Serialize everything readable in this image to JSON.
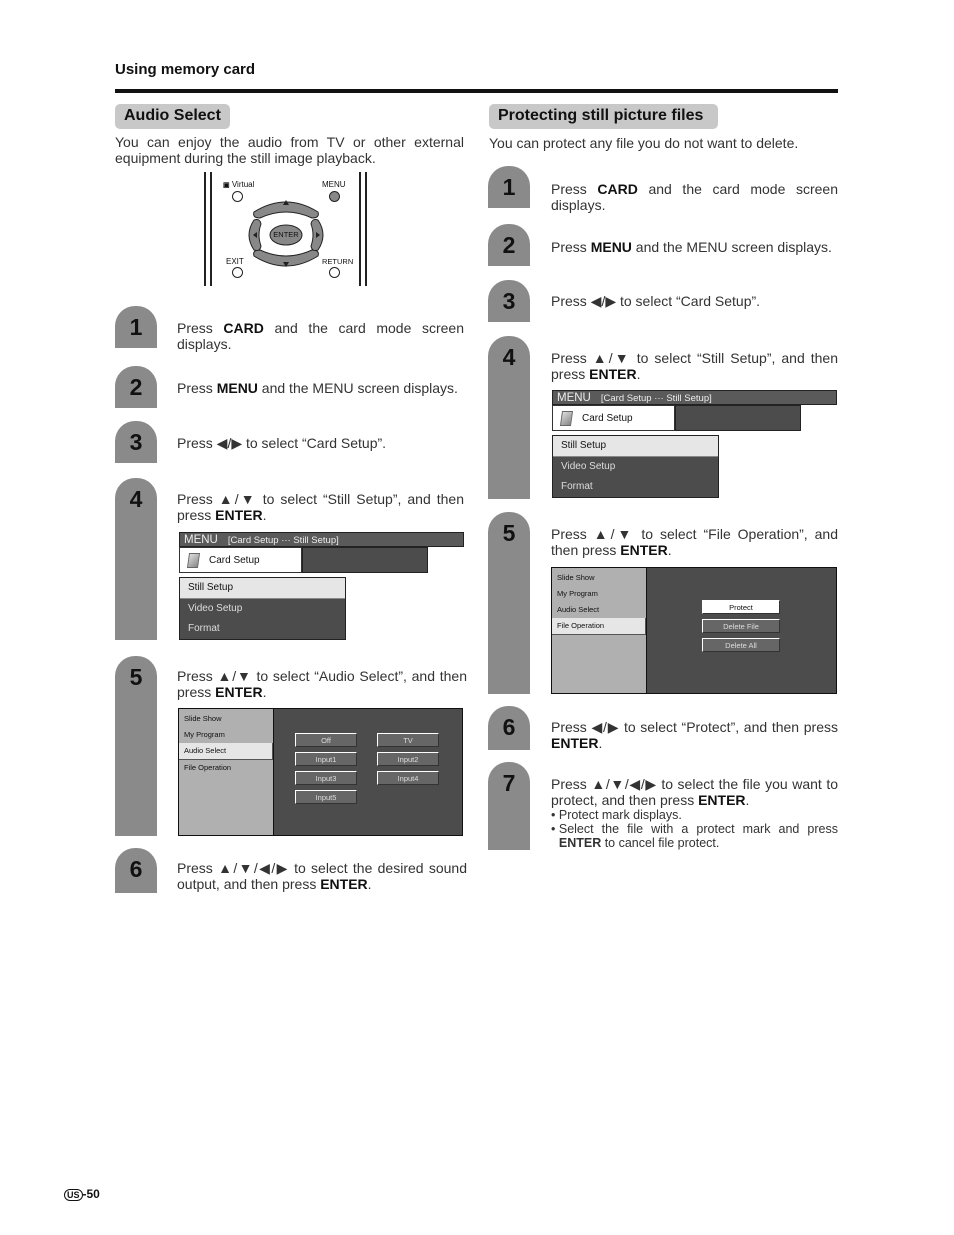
{
  "page": {
    "section_title": "Using memory card",
    "page_number_prefix": "US",
    "page_number": "-50"
  },
  "audio_select": {
    "title": "Audio Select",
    "intro": "You can enjoy the audio from TV or other external equipment during the still image playback.",
    "remote": {
      "virtual_label": "Virtual",
      "menu_label": "MENU",
      "enter_label": "ENTER",
      "exit_label": "EXIT",
      "return_label": "RETURN"
    },
    "steps": [
      {
        "num": "1",
        "pre": "Press ",
        "bold": "CARD",
        "post": " and the card mode screen displays."
      },
      {
        "num": "2",
        "pre": "Press ",
        "bold": "MENU",
        "post": " and the MENU screen displays."
      },
      {
        "num": "3",
        "text": "Press ◀/▶ to select “Card Setup”."
      },
      {
        "num": "4",
        "pre": "Press ▲/▼ to select “Still Setup”, and then press ",
        "bold": "ENTER",
        "post": "."
      },
      {
        "num": "5",
        "pre": "Press ▲/▼ to select “Audio Select”, and then press ",
        "bold": "ENTER",
        "post": "."
      },
      {
        "num": "6",
        "pre": "Press ▲/▼/◀/▶ to select the desired sound output, and then press ",
        "bold": "ENTER",
        "post": "."
      }
    ],
    "menu_screen": {
      "menu": "MENU",
      "path": "[Card Setup ··· Still Setup]",
      "card_setup": "Card Setup",
      "items": [
        "Still Setup",
        "Video Setup",
        "Format"
      ],
      "selected": "Still Setup"
    },
    "option_screen": {
      "left_items": [
        "Slide Show",
        "My Program",
        "Audio Select",
        "File Operation"
      ],
      "selected_left": "Audio Select",
      "options": [
        "Off",
        "TV",
        "Input1",
        "Input2",
        "Input3",
        "Input4",
        "Input5"
      ]
    }
  },
  "protecting": {
    "title": "Protecting still picture files",
    "intro": "You can protect any file you do not want to delete.",
    "steps": [
      {
        "num": "1",
        "pre": "Press ",
        "bold": "CARD",
        "post": " and the card mode screen displays."
      },
      {
        "num": "2",
        "pre": "Press ",
        "bold": "MENU",
        "post": " and the MENU screen displays."
      },
      {
        "num": "3",
        "text": "Press ◀/▶ to select “Card Setup”."
      },
      {
        "num": "4",
        "pre": "Press ▲/▼ to select “Still Setup”, and then press ",
        "bold": "ENTER",
        "post": "."
      },
      {
        "num": "5",
        "pre": "Press ▲/▼ to select “File Operation”, and then press ",
        "bold": "ENTER",
        "post": "."
      },
      {
        "num": "6",
        "pre": "Press ◀/▶ to select “Protect”, and then press ",
        "bold": "ENTER",
        "post": "."
      },
      {
        "num": "7",
        "pre": "Press ▲/▼/◀/▶ to select the file you want to protect, and then press ",
        "bold": "ENTER",
        "post": ".",
        "bullets": [
          {
            "text": "Protect mark displays."
          },
          {
            "pre": "Select the file with a protect mark and press ",
            "bold": "ENTER",
            "post": " to cancel file protect."
          }
        ]
      }
    ],
    "menu_screen": {
      "menu": "MENU",
      "path": "[Card Setup ··· Still Setup]",
      "card_setup": "Card Setup",
      "items": [
        "Still Setup",
        "Video Setup",
        "Format"
      ],
      "selected": "Still Setup"
    },
    "option_screen": {
      "left_items": [
        "Slide Show",
        "My Program",
        "Audio Select",
        "File Operation"
      ],
      "selected_left": "File Operation",
      "options": [
        "Protect",
        "Delete File",
        "Delete All"
      ],
      "selected_option": "Protect"
    }
  }
}
